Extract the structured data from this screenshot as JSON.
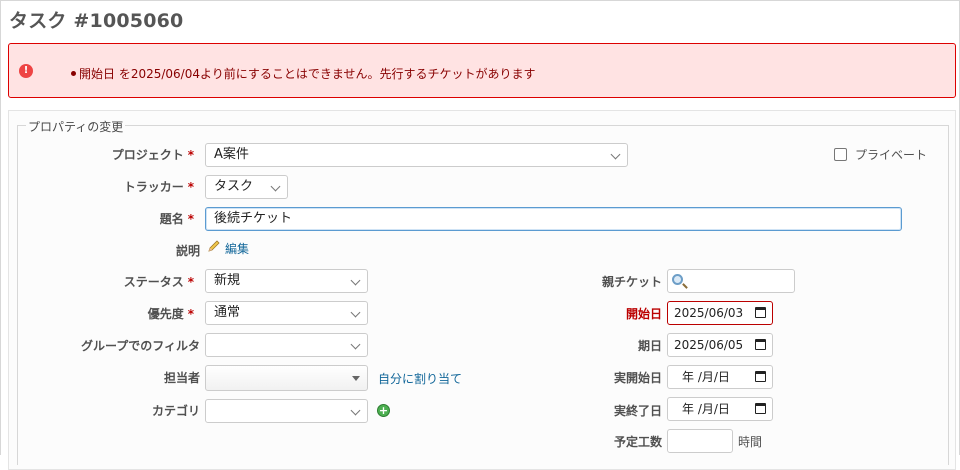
{
  "page": {
    "title": "タスク #1005060"
  },
  "flash": {
    "message": "開始日 を2025/06/04より前にすることはできません。先行するチケットがあります"
  },
  "form": {
    "legend": "プロパティの変更",
    "project": {
      "label": "プロジェクト",
      "value": "A案件"
    },
    "private": {
      "label": "プライベート",
      "checked": false
    },
    "tracker": {
      "label": "トラッカー",
      "value": "タスク"
    },
    "subject": {
      "label": "題名",
      "value": "後続チケット"
    },
    "description": {
      "label": "説明",
      "edit_link": "編集"
    },
    "status": {
      "label": "ステータス",
      "value": "新規"
    },
    "priority": {
      "label": "優先度",
      "value": "通常"
    },
    "group_filter": {
      "label": "グループでのフィルタ",
      "value": ""
    },
    "assignee": {
      "label": "担当者",
      "value": "",
      "assign_to_me": "自分に割り当て"
    },
    "category": {
      "label": "カテゴリ",
      "value": ""
    },
    "parent": {
      "label": "親チケット",
      "value": ""
    },
    "start_date": {
      "label": "開始日",
      "value": "2025/06/03"
    },
    "due_date": {
      "label": "期日",
      "value": "2025/06/05"
    },
    "actual_start": {
      "label": "実開始日",
      "value": "年 /月/日"
    },
    "actual_end": {
      "label": "実終了日",
      "value": "年 /月/日"
    },
    "estimated_hours": {
      "label": "予定工数",
      "value": "",
      "unit": "時間"
    },
    "required_mark": "*"
  },
  "colors": {
    "error": "#bb0000",
    "link": "#116699",
    "flash_bg": "#ffe3e3"
  },
  "icons": [
    "error-icon",
    "pencil-icon",
    "search-icon",
    "calendar-icon",
    "add-icon"
  ]
}
